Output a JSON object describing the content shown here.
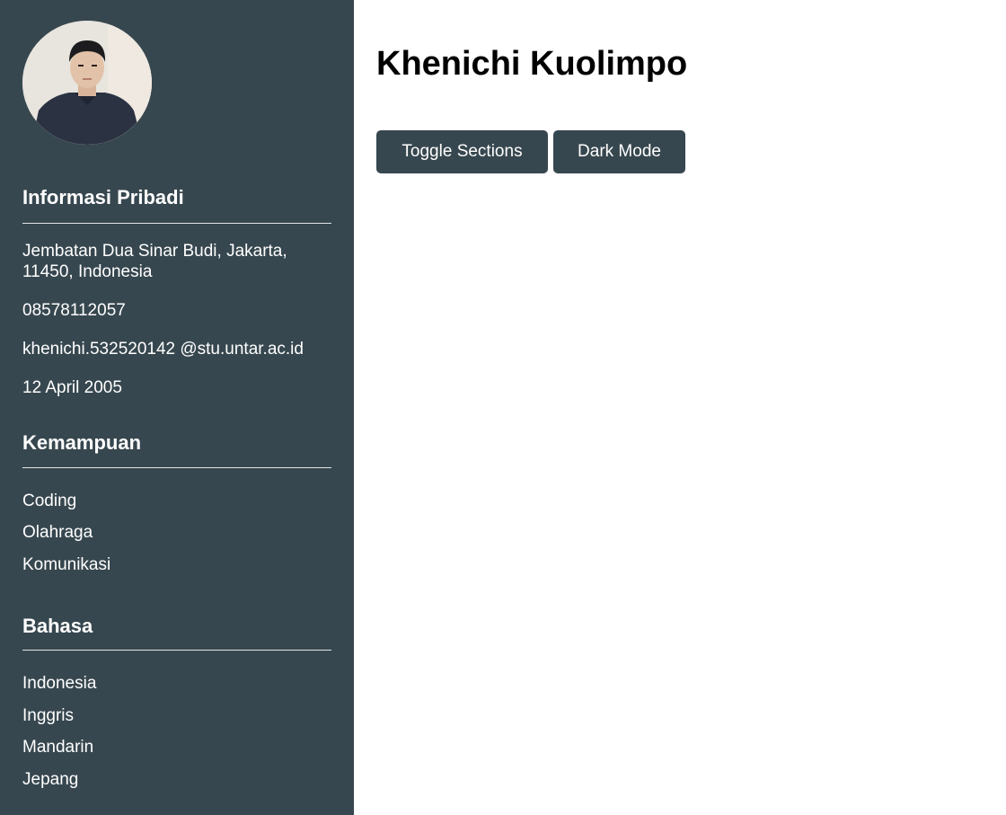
{
  "profile": {
    "name": "Khenichi Kuolimpo"
  },
  "buttons": {
    "toggle_label": "Toggle Sections",
    "dark_label": "Dark Mode"
  },
  "personal": {
    "title": "Informasi Pribadi",
    "address": "Jembatan Dua Sinar Budi, Jakarta, 11450, Indonesia",
    "phone": "08578112057",
    "email": "khenichi.532520142 @stu.untar.ac.id",
    "birthdate": "12 April 2005"
  },
  "skills": {
    "title": "Kemampuan",
    "items": [
      "Coding",
      "Olahraga",
      "Komunikasi"
    ]
  },
  "languages": {
    "title": "Bahasa",
    "items": [
      "Indonesia",
      "Inggris",
      "Mandarin",
      "Jepang"
    ]
  },
  "colors": {
    "sidebar": "#37474f",
    "button": "#37474f",
    "text_light": "#ffffff"
  }
}
